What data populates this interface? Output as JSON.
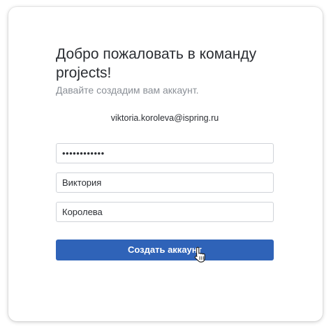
{
  "welcome": {
    "title": "Добро пожаловать в команду projects!",
    "subtitle": "Давайте создадим вам аккаунт.",
    "email": "viktoria.koroleva@ispring.ru"
  },
  "form": {
    "password_value": "••••••••••••",
    "first_name_value": "Виктория",
    "last_name_value": "Королева",
    "submit_label": "Создать аккаунт"
  },
  "colors": {
    "accent": "#2f63b8",
    "text": "#2b2e33",
    "muted": "#8a8f96",
    "border": "#cfd3d8"
  },
  "icons": {
    "cursor": "hand-pointer-icon"
  }
}
